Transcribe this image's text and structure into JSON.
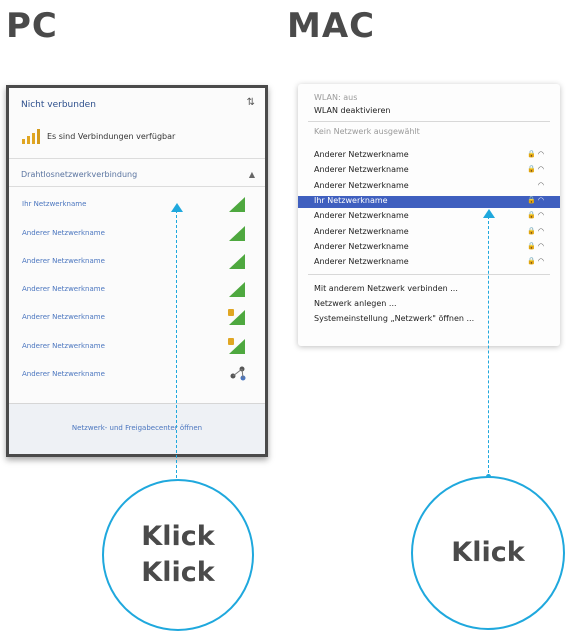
{
  "headings": {
    "pc": "PC",
    "mac": "MAC"
  },
  "pc": {
    "title": "Nicht verbunden",
    "status": "Es sind Verbindungen verfügbar",
    "section": "Drahtlosnetzwerkverbindung",
    "networks": [
      "Ihr Netzwerkname",
      "Anderer Netzwerkname",
      "Anderer Netzwerkname",
      "Anderer Netzwerkname",
      "Anderer Netzwerkname",
      "Anderer Netzwerkname",
      "Anderer Netzwerkname"
    ],
    "footer": "Netzwerk- und Freigabecenter öffnen"
  },
  "mac": {
    "wifi_status": "WLAN: aus",
    "wifi_toggle": "WLAN deaktivieren",
    "section": "Kein Netzwerk ausgewählt",
    "networks": [
      "Anderer Netzwerkname",
      "Anderer Netzwerkname",
      "Anderer Netzwerkname",
      "Ihr Netzwerkname",
      "Anderer Netzwerkname",
      "Anderer Netzwerkname",
      "Anderer Netzwerkname",
      "Anderer Netzwerkname"
    ],
    "actions": [
      "Mit anderem Netzwerk verbinden ...",
      "Netzwerk anlegen ...",
      "Systemeinstellung „Netzwerk\" öffnen ..."
    ]
  },
  "callouts": {
    "pc_line1": "Klick",
    "pc_line2": "Klick",
    "mac": "Klick"
  },
  "colors": {
    "accent": "#1fa8dd",
    "selection": "#3f5fbf",
    "link": "#4b76bf"
  }
}
